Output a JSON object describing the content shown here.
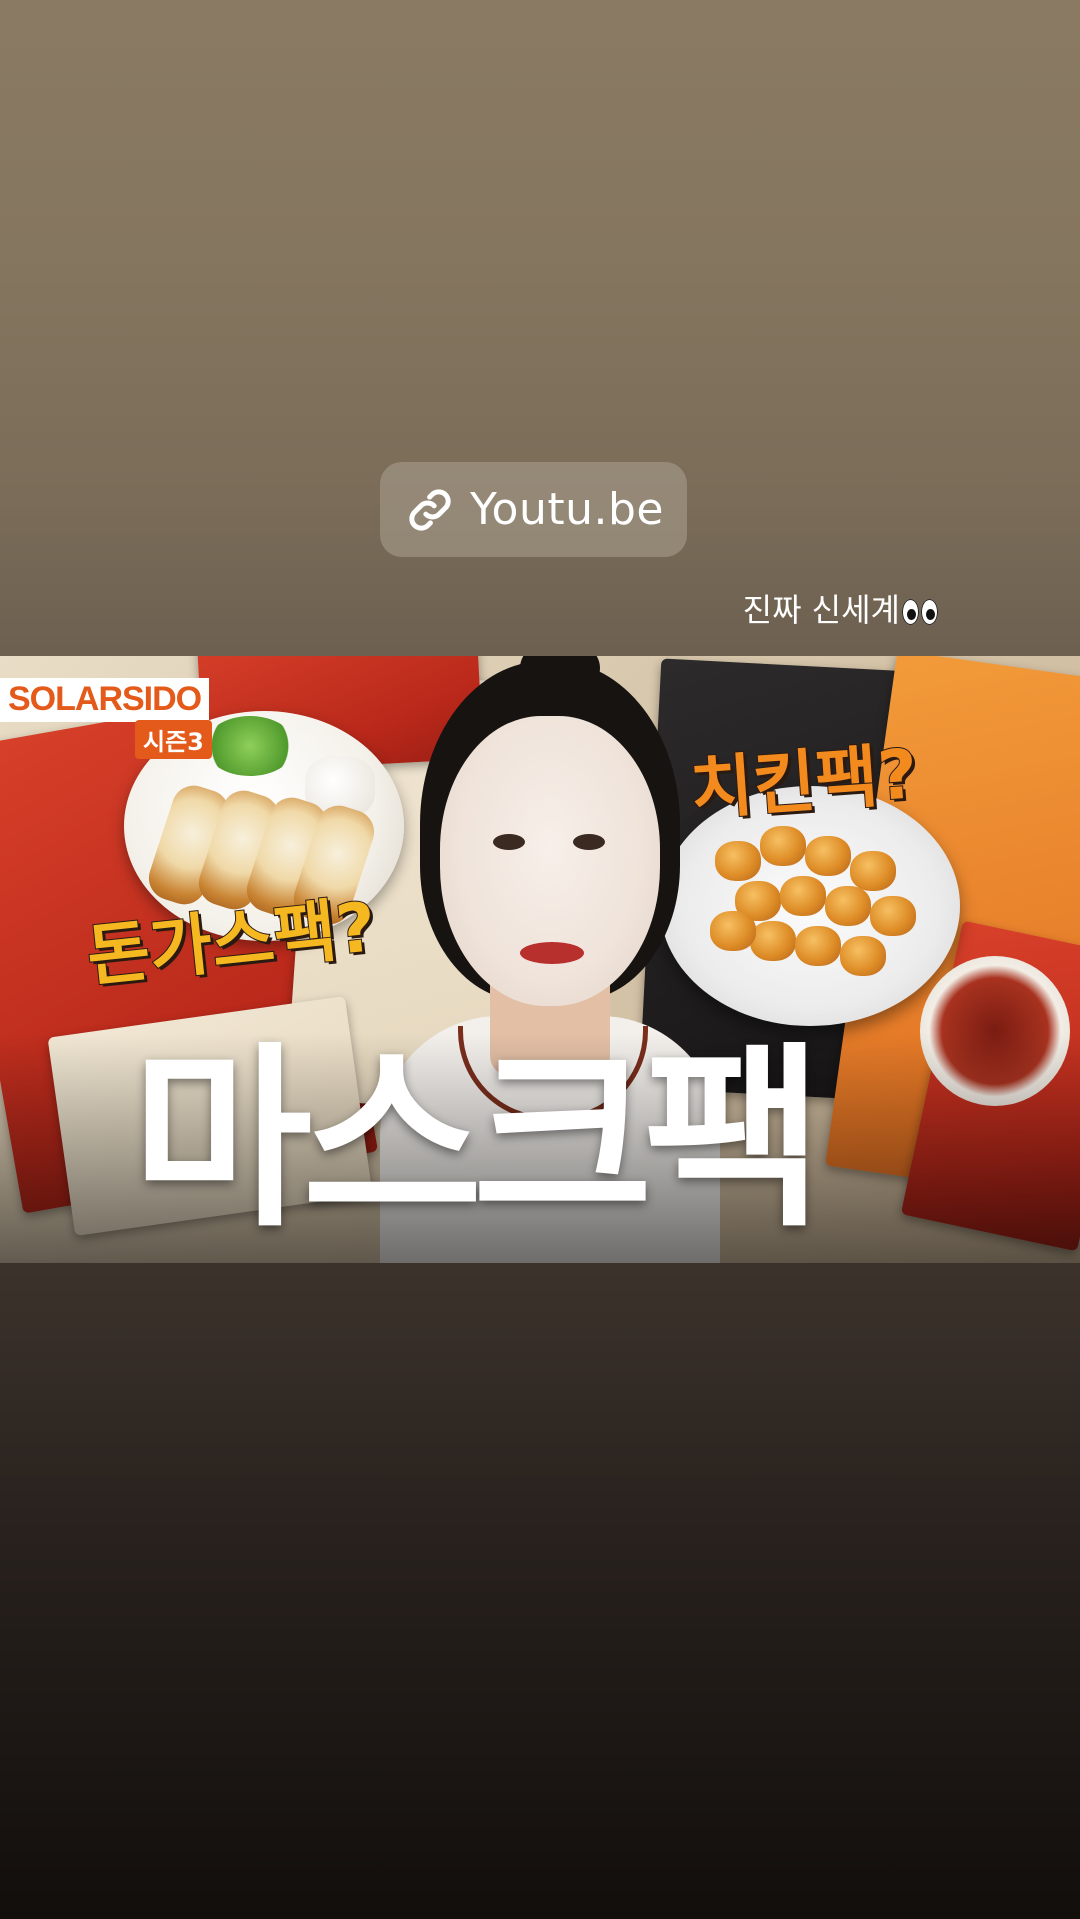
{
  "link_sticker": {
    "label": "Youtu.be",
    "icon": "link-icon"
  },
  "caption": {
    "text": "진짜 신세계",
    "emoji": "eyes-emoji"
  },
  "thumbnail": {
    "brand": "SOLARSIDO",
    "season": "시즌3",
    "tag_left": "돈가스팩?",
    "tag_right": "치킨팩?",
    "title": "마스크팩"
  },
  "colors": {
    "brand_orange": "#e45a1a",
    "tag_yellow": "#f5b820",
    "tag_orange": "#f28a1e"
  }
}
